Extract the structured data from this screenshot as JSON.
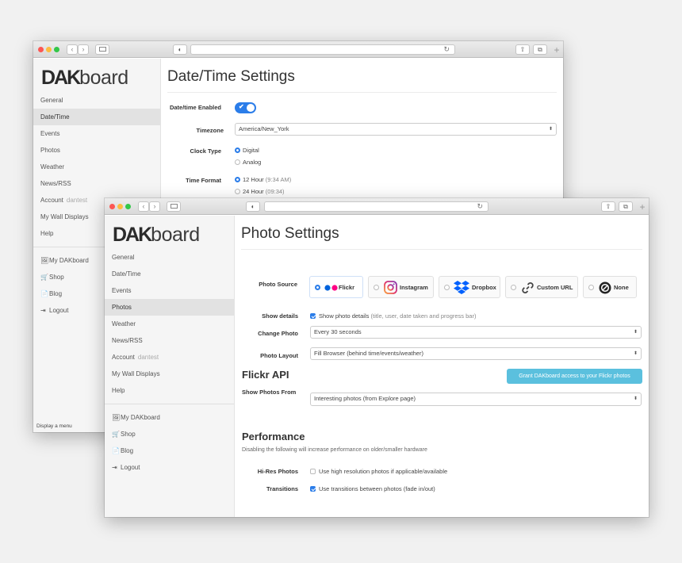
{
  "brand": {
    "logo_bold": "DAK",
    "logo_light": "board"
  },
  "colors": {
    "accent": "#2b7de9",
    "button": "#5bc0de",
    "flickr_blue": "#0063dc",
    "flickr_pink": "#ff0084",
    "dropbox": "#0061fe"
  },
  "back_window": {
    "toolbar": {
      "back": "‹",
      "forward": "›",
      "reload": "↻",
      "shield": "◐",
      "share": "⇧",
      "tabs": "⧉",
      "plus": "+"
    },
    "sidebar": {
      "items": [
        {
          "label": "General"
        },
        {
          "label": "Date/Time"
        },
        {
          "label": "Events"
        },
        {
          "label": "Photos"
        },
        {
          "label": "Weather"
        },
        {
          "label": "News/RSS"
        },
        {
          "label": "Account",
          "muted": "dantest"
        },
        {
          "label": "My Wall Displays"
        },
        {
          "label": "Help"
        }
      ],
      "links": [
        {
          "icon": "🖼",
          "label": "My DAKboard"
        },
        {
          "icon": "🛒",
          "label": "Shop"
        },
        {
          "icon": "📄",
          "label": "Blog"
        },
        {
          "icon": "⇥",
          "label": "Logout"
        }
      ],
      "footer": "Display a menu"
    },
    "main": {
      "title": "Date/Time Settings",
      "enabled_label": "Date/time Enabled",
      "toggle_check": "✔",
      "timezone_label": "Timezone",
      "timezone_value": "America/New_York",
      "clock_type_label": "Clock Type",
      "clock_options": [
        "Digital",
        "Analog"
      ],
      "time_format_label": "Time Format",
      "time_format_options": [
        {
          "label": "12 Hour",
          "example": "(9:34 AM)"
        },
        {
          "label": "24 Hour",
          "example": "(09:34)"
        }
      ]
    }
  },
  "front_window": {
    "sidebar": {
      "items": [
        {
          "label": "General"
        },
        {
          "label": "Date/Time"
        },
        {
          "label": "Events"
        },
        {
          "label": "Photos"
        },
        {
          "label": "Weather"
        },
        {
          "label": "News/RSS"
        },
        {
          "label": "Account",
          "muted": "dantest"
        },
        {
          "label": "My Wall Displays"
        },
        {
          "label": "Help"
        }
      ],
      "links": [
        {
          "icon": "🖼",
          "label": "My DAKboard"
        },
        {
          "icon": "🛒",
          "label": "Shop"
        },
        {
          "icon": "📄",
          "label": "Blog"
        },
        {
          "icon": "⇥",
          "label": "Logout"
        }
      ]
    },
    "main": {
      "title": "Photo Settings",
      "photo_source_label": "Photo Source",
      "sources": [
        "Flickr",
        "Instagram",
        "Dropbox",
        "Custom URL",
        "None"
      ],
      "show_details_label": "Show details",
      "show_details_text": "Show photo details",
      "show_details_hint": "(title, user, date taken and progress bar)",
      "change_photo_label": "Change Photo",
      "change_photo_value": "Every 30 seconds",
      "photo_layout_label": "Photo Layout",
      "photo_layout_value": "Fill Browser (behind time/events/weather)",
      "flickr_title": "Flickr API",
      "grant_button": "Grant DAKboard access to your Flickr photos",
      "show_from_label": "Show Photos From",
      "show_from_value": "Interesting photos (from Explore page)",
      "performance_title": "Performance",
      "performance_desc": "Disabling the following will increase performance on older/smaller hardware",
      "hires_label": "Hi-Res Photos",
      "hires_text": "Use high resolution photos if applicable/available",
      "transitions_label": "Transitions",
      "transitions_text": "Use transitions between photos (fade in/out)"
    }
  }
}
